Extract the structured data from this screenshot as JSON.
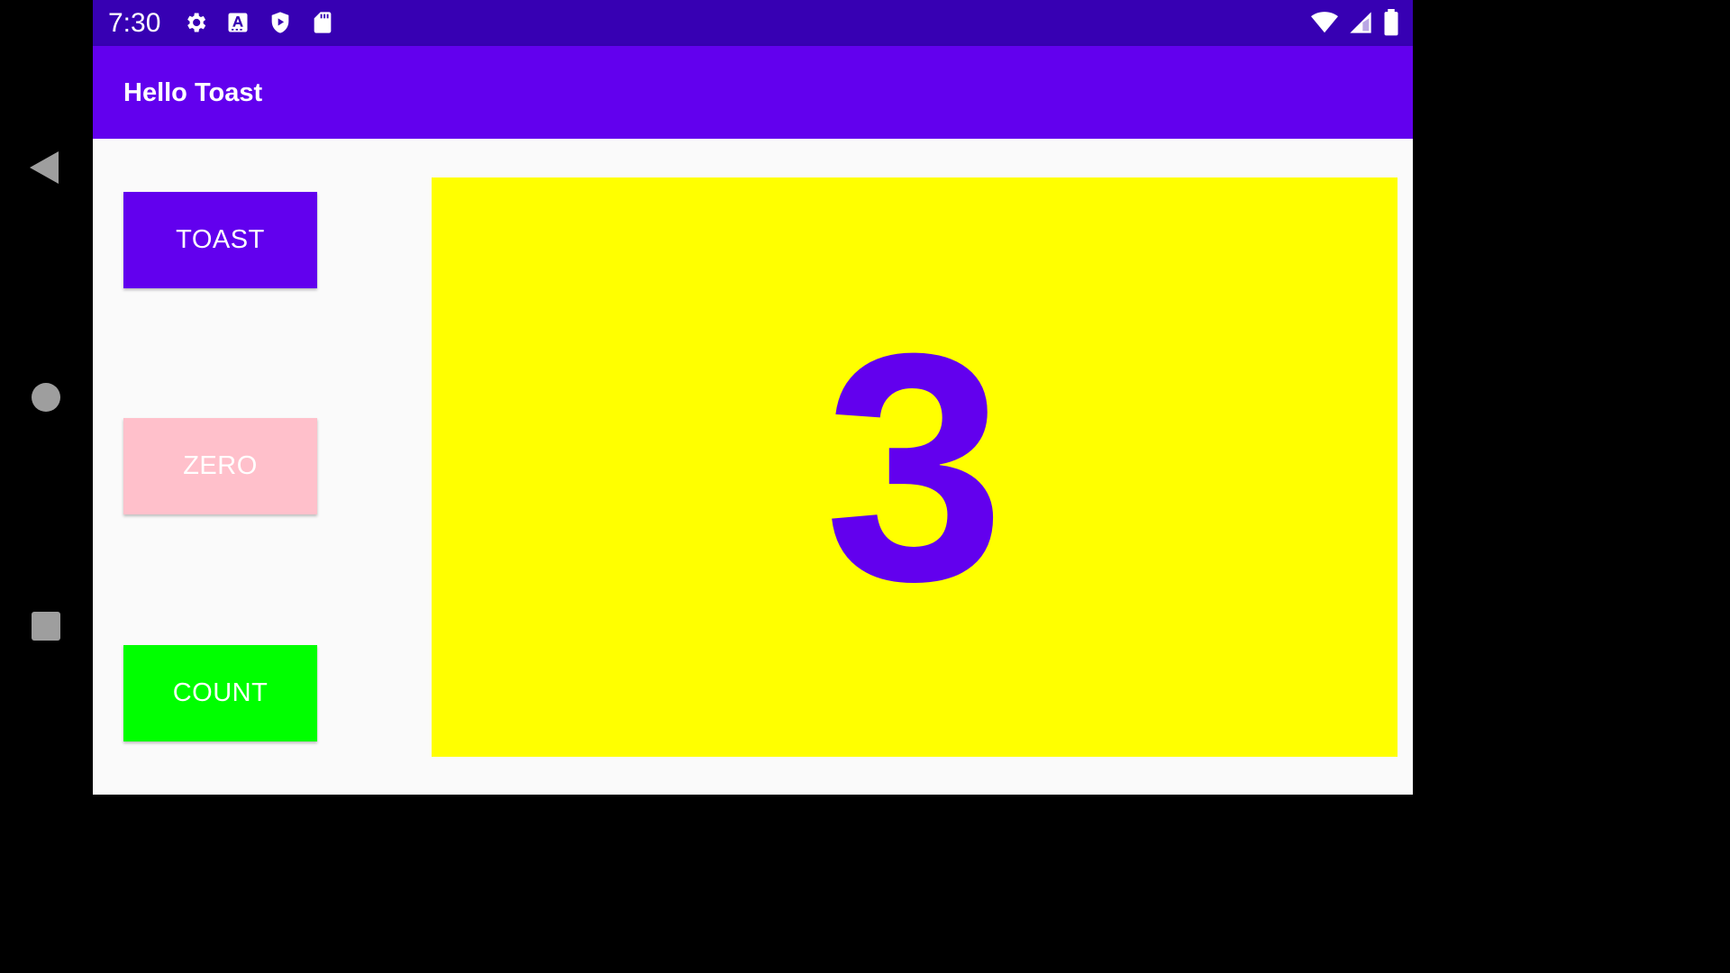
{
  "status_bar": {
    "time": "7:30",
    "left_icons": [
      "gear-icon",
      "text-a-icon",
      "shield-play-icon",
      "sd-card-icon"
    ],
    "right_icons": [
      "wifi-icon",
      "signal-icon",
      "battery-icon"
    ],
    "color": "#3700b3"
  },
  "app_bar": {
    "title": "Hello Toast",
    "color": "#6200ee"
  },
  "buttons": {
    "toast": {
      "label": "TOAST",
      "color": "#6200ee"
    },
    "zero": {
      "label": "ZERO",
      "color": "#ffc0cb"
    },
    "count": {
      "label": "COUNT",
      "color": "#00ff00"
    }
  },
  "counter": {
    "value": "3",
    "background": "#ffff00",
    "text_color": "#6200ee"
  },
  "navigation": {
    "icons": [
      "back-icon",
      "home-icon",
      "recents-icon"
    ]
  }
}
